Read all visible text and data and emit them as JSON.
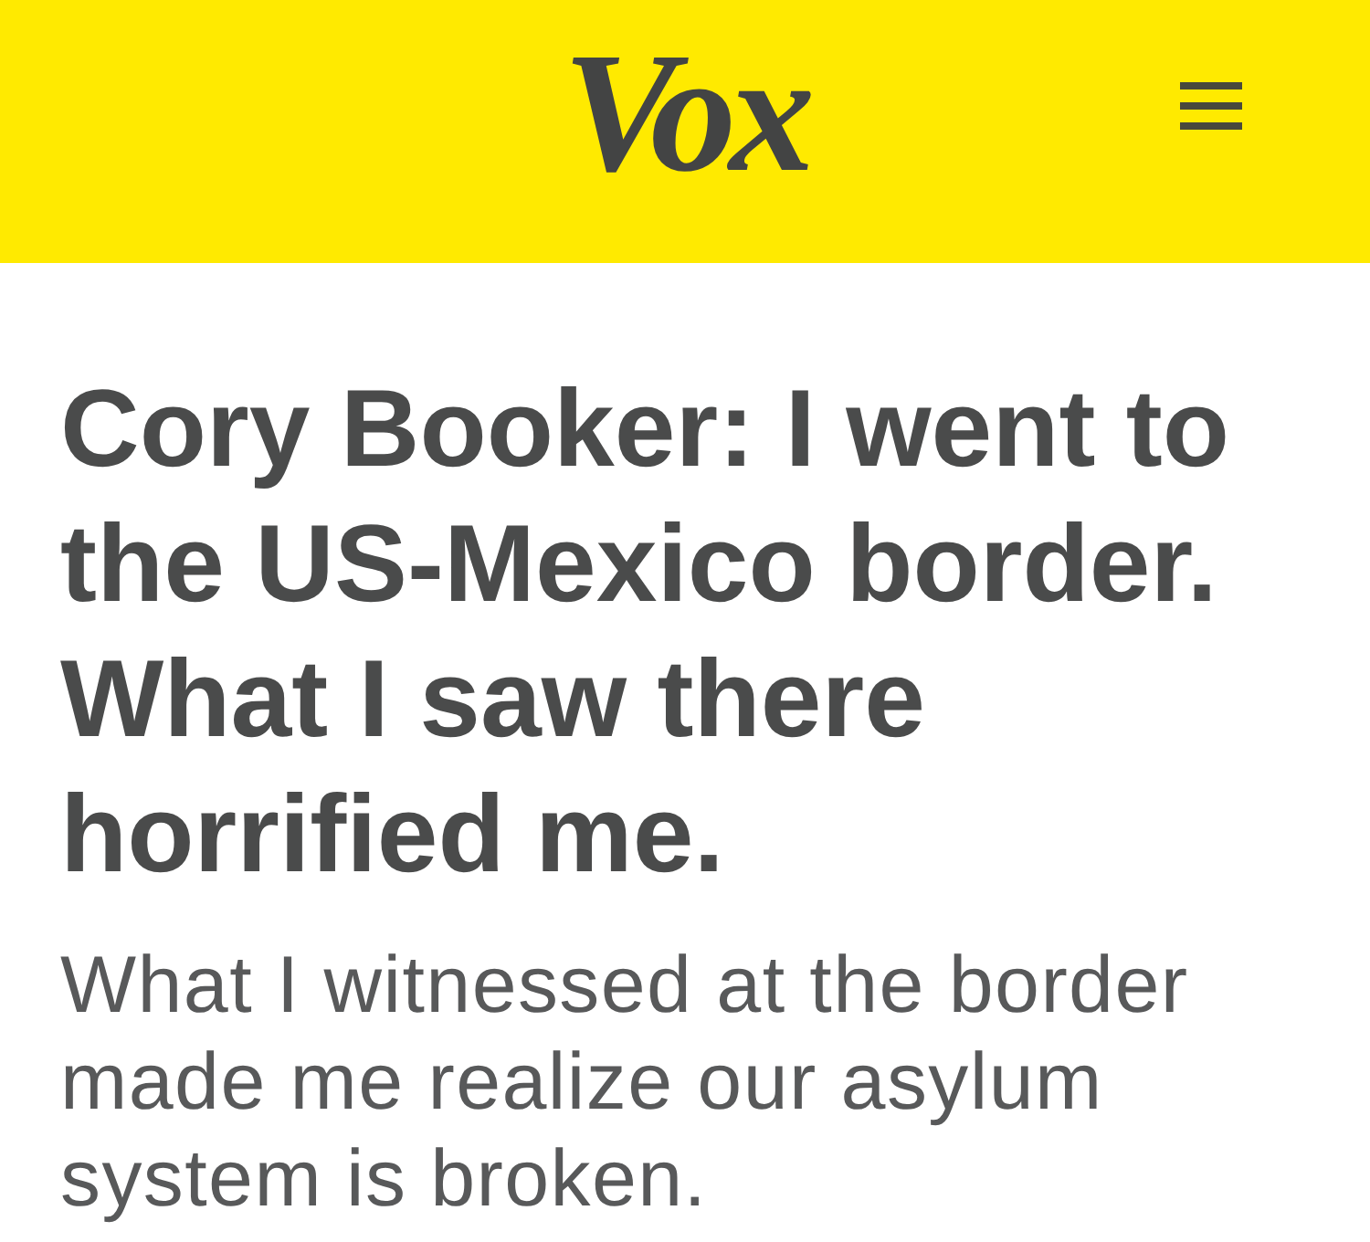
{
  "header": {
    "logo": "Vox"
  },
  "article": {
    "headline": "Cory Booker: I went to the US-Mexico border. What I saw there horrified me.",
    "dek": "What I witnessed at the border made me realize our asylum system is broken."
  }
}
